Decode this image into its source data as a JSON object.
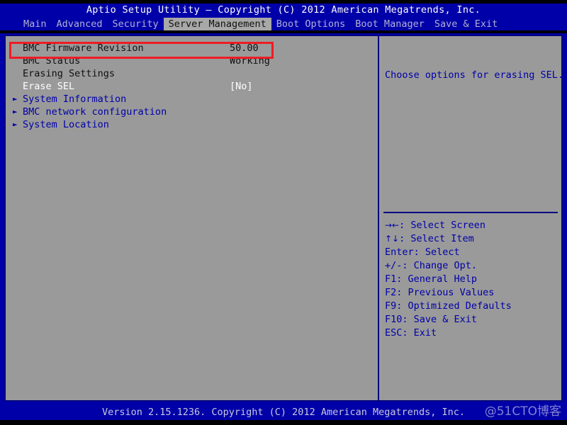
{
  "window": {
    "title": "Aptio Setup Utility – Copyright (C) 2012 American Megatrends, Inc."
  },
  "menubar": {
    "items": [
      {
        "label": "Main",
        "active": false
      },
      {
        "label": "Advanced",
        "active": false
      },
      {
        "label": "Security",
        "active": false
      },
      {
        "label": "Server Management",
        "active": true
      },
      {
        "label": "Boot Options",
        "active": false
      },
      {
        "label": "Boot Manager",
        "active": false
      },
      {
        "label": "Save & Exit",
        "active": false
      }
    ]
  },
  "settings": {
    "rows": [
      {
        "arrow": "",
        "label": "BMC Firmware Revision",
        "value": "50.00",
        "style": "dark"
      },
      {
        "arrow": "",
        "label": "BMC Status",
        "value": "Working",
        "style": "dark"
      },
      {
        "arrow": "",
        "label": "Erasing Settings",
        "value": "",
        "style": "dark"
      },
      {
        "arrow": "",
        "label": "Erase SEL",
        "value": "[No]",
        "style": "white"
      },
      {
        "arrow": "►",
        "label": "System Information",
        "value": "",
        "style": "navy"
      },
      {
        "arrow": "►",
        "label": "BMC network configuration",
        "value": "",
        "style": "navy"
      },
      {
        "arrow": "►",
        "label": "System Location",
        "value": "",
        "style": "navy"
      }
    ]
  },
  "help": {
    "text": "Choose options for erasing SEL."
  },
  "legend": {
    "rows": [
      {
        "glyph": "→←",
        "text": ": Select Screen"
      },
      {
        "glyph": "↑↓",
        "text": ": Select Item"
      },
      {
        "glyph": "",
        "text": "Enter: Select"
      },
      {
        "glyph": "",
        "text": "+/-: Change Opt."
      },
      {
        "glyph": "",
        "text": "F1: General Help"
      },
      {
        "glyph": "",
        "text": "F2: Previous Values"
      },
      {
        "glyph": "",
        "text": "F9: Optimized Defaults"
      },
      {
        "glyph": "",
        "text": "F10: Save & Exit"
      },
      {
        "glyph": "",
        "text": "ESC: Exit"
      }
    ]
  },
  "footer": {
    "text": "Version 2.15.1236. Copyright (C) 2012 American Megatrends, Inc."
  },
  "watermark": {
    "text": "@51CTO博客"
  },
  "annotation": {
    "target_row": "BMC Firmware Revision",
    "color": "#ee1c25"
  },
  "colors": {
    "background_blue": "#0000a8",
    "panel_gray": "#9a9a9a",
    "active_tab_gray": "#a8a8a8",
    "navy_text": "#0000a8",
    "annotation_red": "#ee1c25"
  }
}
